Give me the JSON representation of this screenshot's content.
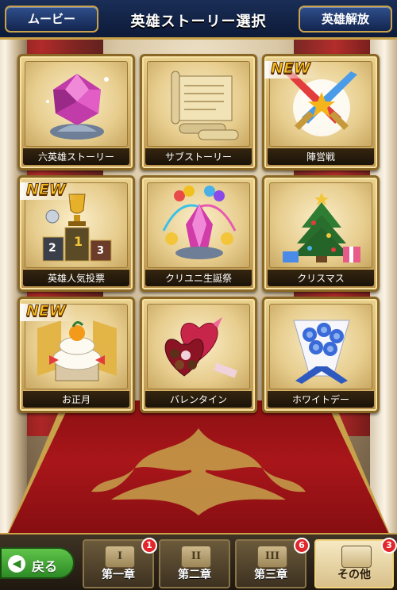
{
  "header": {
    "title": "英雄ストーリー選択",
    "left_button": "ムービー",
    "right_button": "英雄解放"
  },
  "cards": [
    {
      "label": "六英雄ストーリー",
      "new": false,
      "icon": "crystal-gem-icon"
    },
    {
      "label": "サブストーリー",
      "new": false,
      "icon": "scrolls-icon"
    },
    {
      "label": "陣営戦",
      "new": true,
      "new_text": "NEW",
      "icon": "crossed-swords-icon"
    },
    {
      "label": "英雄人気投票",
      "new": true,
      "new_text": "NEW",
      "icon": "trophy-podium-icon"
    },
    {
      "label": "クリユニ生誕祭",
      "new": false,
      "icon": "festival-crystal-icon"
    },
    {
      "label": "クリスマス",
      "new": false,
      "icon": "christmas-tree-icon"
    },
    {
      "label": "お正月",
      "new": true,
      "new_text": "NEW",
      "icon": "kagami-mochi-icon"
    },
    {
      "label": "バレンタイン",
      "new": false,
      "icon": "chocolate-box-icon"
    },
    {
      "label": "ホワイトデー",
      "new": false,
      "icon": "bouquet-icon"
    }
  ],
  "podium_numbers": [
    "2",
    "1",
    "3"
  ],
  "footer": {
    "back_label": "戻る",
    "chapters": [
      {
        "name": "第一章",
        "numeral": "I",
        "badge": "1"
      },
      {
        "name": "第二章",
        "numeral": "II",
        "badge": ""
      },
      {
        "name": "第三章",
        "numeral": "III",
        "badge": "6"
      },
      {
        "name": "その他",
        "numeral": "",
        "badge": "3",
        "active": true
      }
    ]
  }
}
